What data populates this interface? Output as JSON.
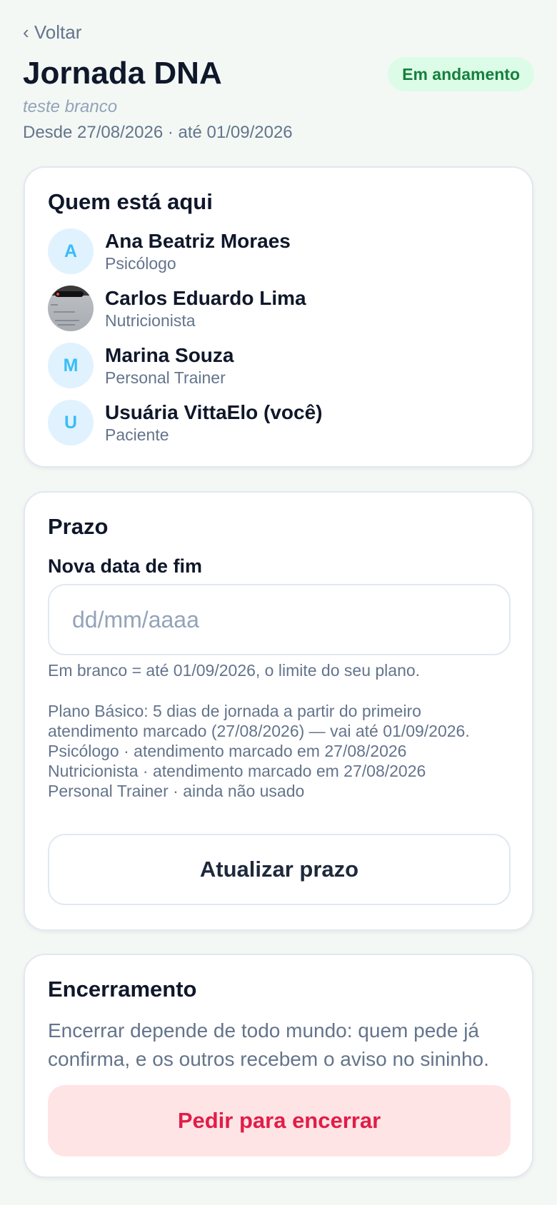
{
  "header": {
    "back_label": "‹ Voltar",
    "title": "Jornada DNA",
    "status": "Em andamento",
    "subtitle": "teste branco",
    "dates": "Desde 27/08/2026 · até 01/09/2026"
  },
  "participants": {
    "title": "Quem está aqui",
    "items": [
      {
        "initial": "A",
        "name": "Ana Beatriz Moraes",
        "role": "Psicólogo"
      },
      {
        "initial": "",
        "name": "Carlos Eduardo Lima",
        "role": "Nutricionista"
      },
      {
        "initial": "M",
        "name": "Marina Souza",
        "role": "Personal Trainer"
      },
      {
        "initial": "U",
        "name": "Usuária VittaElo (você)",
        "role": "Paciente"
      }
    ]
  },
  "deadline": {
    "title": "Prazo",
    "field_label": "Nova data de fim",
    "placeholder": "dd/mm/aaaa",
    "hint": "Em branco = até 01/09/2026, o limite do seu plano.",
    "plan_lines": [
      "Plano Básico: 5 dias de jornada a partir do primeiro",
      "atendimento marcado (27/08/2026) — vai até 01/09/2026.",
      "Psicólogo · atendimento marcado em 27/08/2026",
      "Nutricionista · atendimento marcado em 27/08/2026",
      "Personal Trainer · ainda não usado"
    ],
    "button_label": "Atualizar prazo"
  },
  "closing": {
    "title": "Encerramento",
    "text": "Encerrar depende de todo mundo: quem pede já confirma, e os outros recebem o aviso no sininho.",
    "button_label": "Pedir para encerrar"
  },
  "colors": {
    "background": "#f3f8f5",
    "status_bg": "#dcfce7",
    "status_text": "#15803d",
    "avatar_bg": "#e0f2fe",
    "avatar_text": "#38bdf8",
    "danger_bg": "#ffe4e6",
    "danger_text": "#e11d48"
  }
}
